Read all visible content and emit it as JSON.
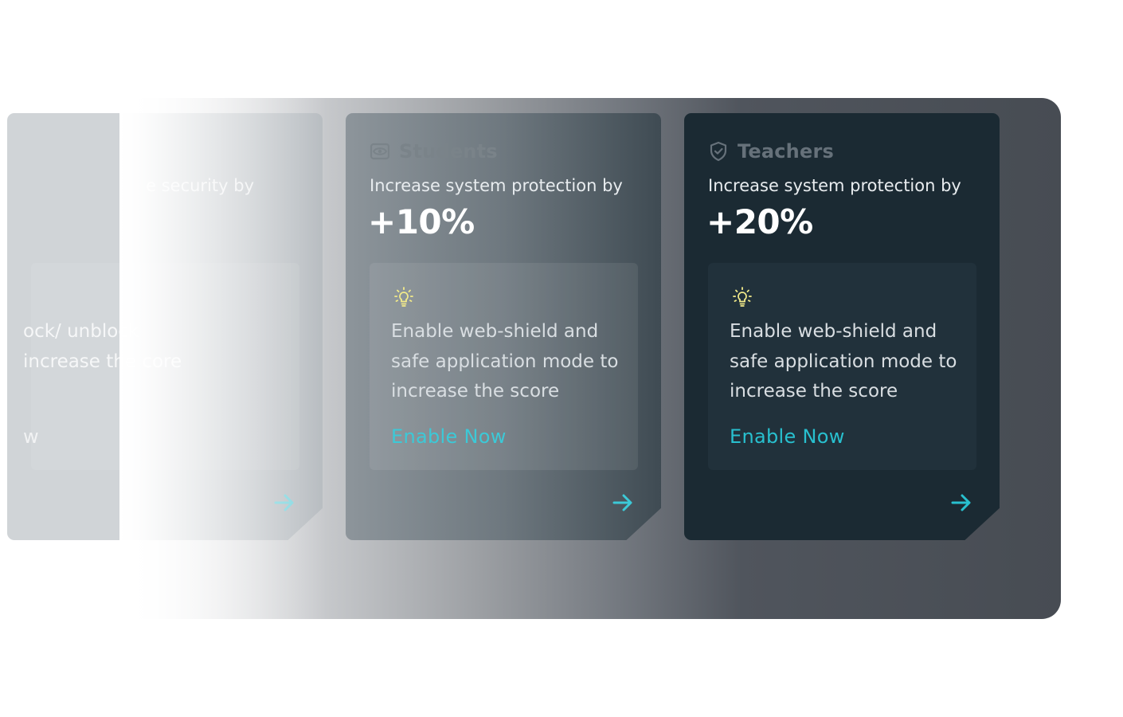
{
  "cards": [
    {
      "title": "",
      "subtitle": "e security by",
      "percent": "",
      "tip_text": "ock/ unblock increase the core",
      "link_label": "w"
    },
    {
      "title": "Students",
      "icon": "eye-camera-icon",
      "subtitle": "Increase system protection by",
      "percent": "+10%",
      "tip_icon": "lightbulb-icon",
      "tip_text": "Enable web-shield and safe application mode to increase the score",
      "link_label": "Enable Now",
      "arrow_icon": "arrow-right-icon"
    },
    {
      "title": "Teachers",
      "icon": "shield-check-icon",
      "subtitle": "Increase system protection by",
      "percent": "+20%",
      "tip_icon": "lightbulb-icon",
      "tip_text": "Enable web-shield and safe application mode to increase the score",
      "link_label": "Enable Now",
      "arrow_icon": "arrow-right-icon"
    }
  ],
  "colors": {
    "accent": "#28c0cf",
    "card_dark": "#1b2a33",
    "bulb": "#f3eb8a"
  }
}
